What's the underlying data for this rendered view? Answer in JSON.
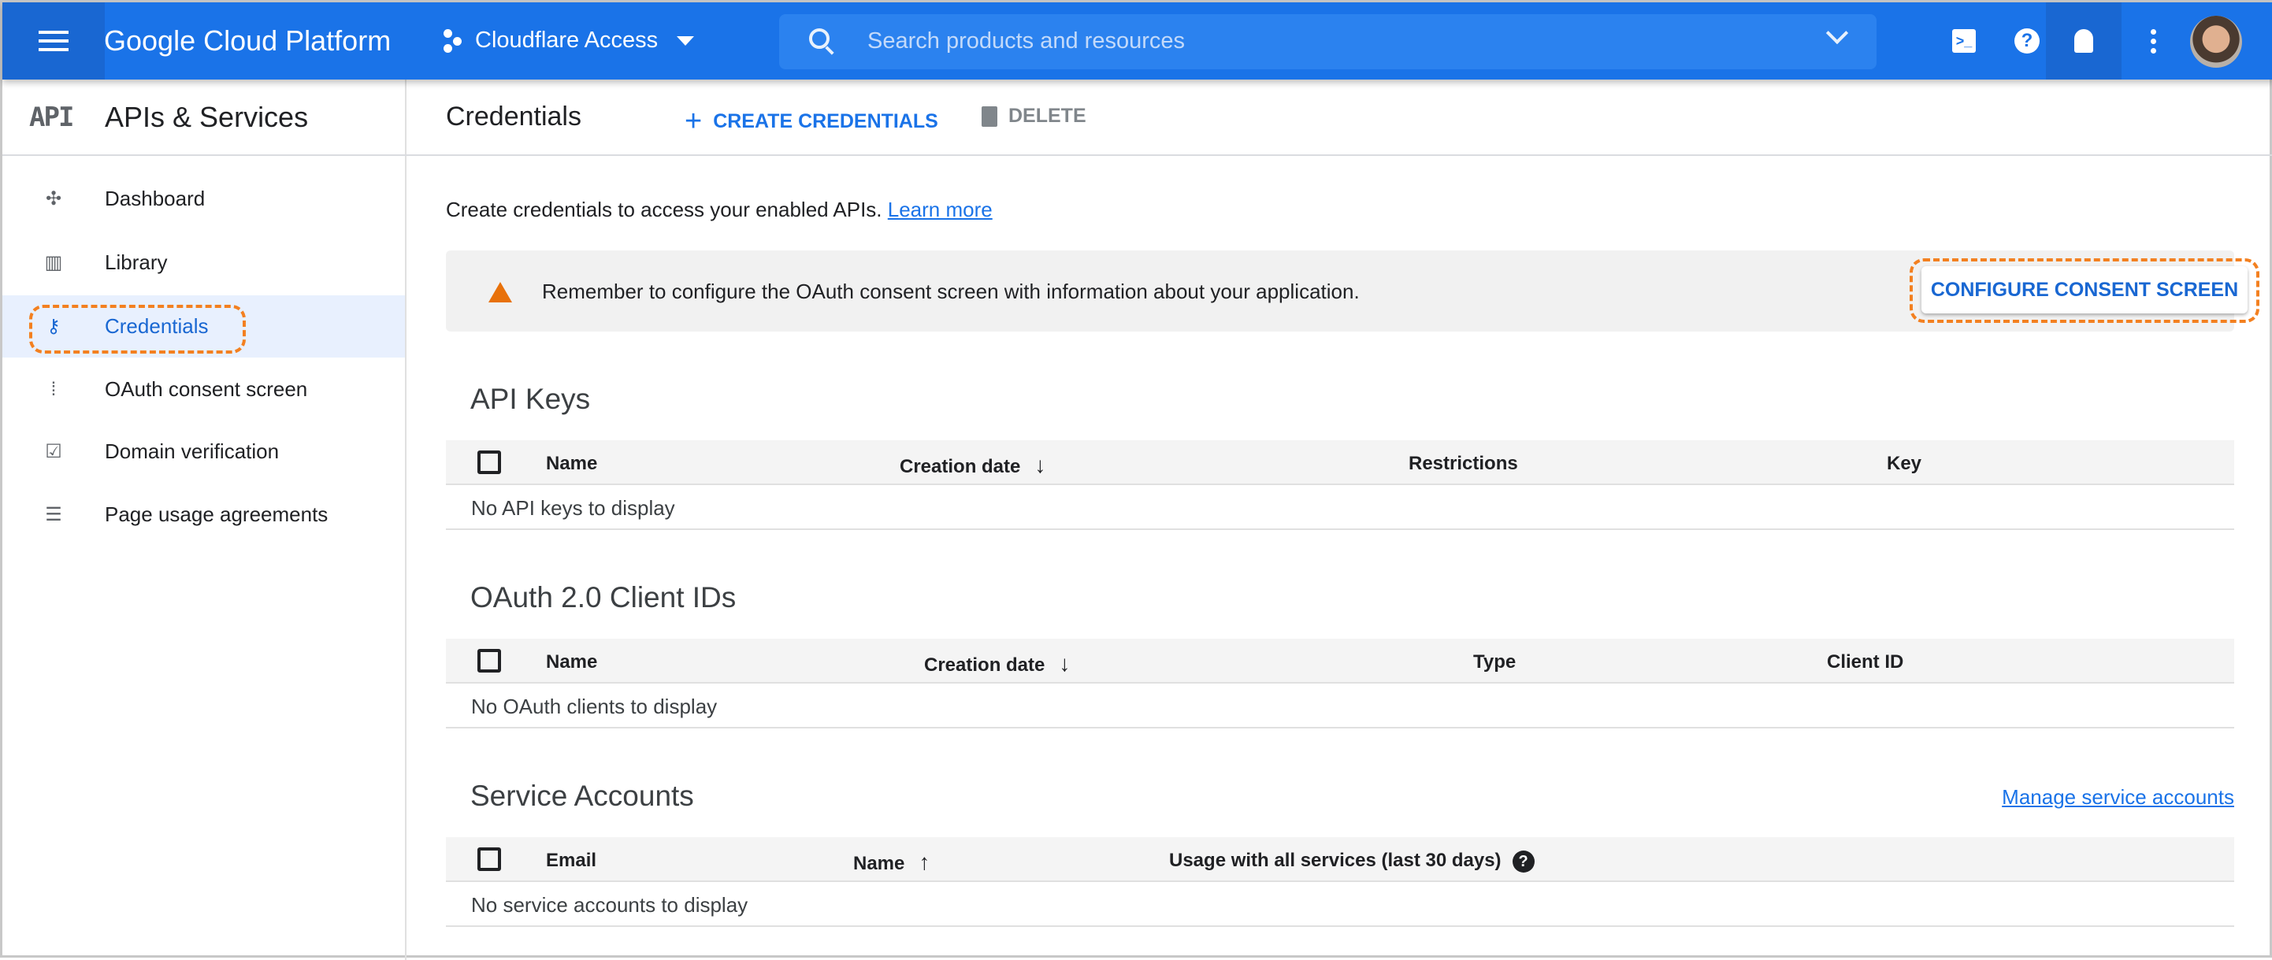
{
  "topbar": {
    "brand": "Google Cloud Platform",
    "project": "Cloudflare Access",
    "search_placeholder": "Search products and resources",
    "brand_color": "#1a73e8"
  },
  "sidebar": {
    "logo": "API",
    "title": "APIs & Services",
    "items": [
      {
        "label": "Dashboard",
        "icon": "dashboard-icon"
      },
      {
        "label": "Library",
        "icon": "library-icon"
      },
      {
        "label": "Credentials",
        "icon": "key-icon",
        "active": true
      },
      {
        "label": "OAuth consent screen",
        "icon": "oauth-icon"
      },
      {
        "label": "Domain verification",
        "icon": "checkbox-icon"
      },
      {
        "label": "Page usage agreements",
        "icon": "settings-list-icon"
      }
    ]
  },
  "main": {
    "title": "Credentials",
    "create_label": "CREATE CREDENTIALS",
    "delete_label": "DELETE",
    "intro": "Create credentials to access your enabled APIs.",
    "learn_more": "Learn more",
    "banner": {
      "text": "Remember to configure the OAuth consent screen with information about your application.",
      "button": "CONFIGURE CONSENT SCREEN"
    },
    "api_keys": {
      "heading": "API Keys",
      "columns": [
        "Name",
        "Creation date",
        "Restrictions",
        "Key"
      ],
      "empty": "No API keys to display"
    },
    "oauth": {
      "heading": "OAuth 2.0 Client IDs",
      "columns": [
        "Name",
        "Creation date",
        "Type",
        "Client ID"
      ],
      "empty": "No OAuth clients to display"
    },
    "service": {
      "heading": "Service Accounts",
      "manage": "Manage service accounts",
      "columns": [
        "Email",
        "Name",
        "Usage with all services (last 30 days)"
      ],
      "empty": "No service accounts to display"
    }
  },
  "highlight_color": "#f38020"
}
